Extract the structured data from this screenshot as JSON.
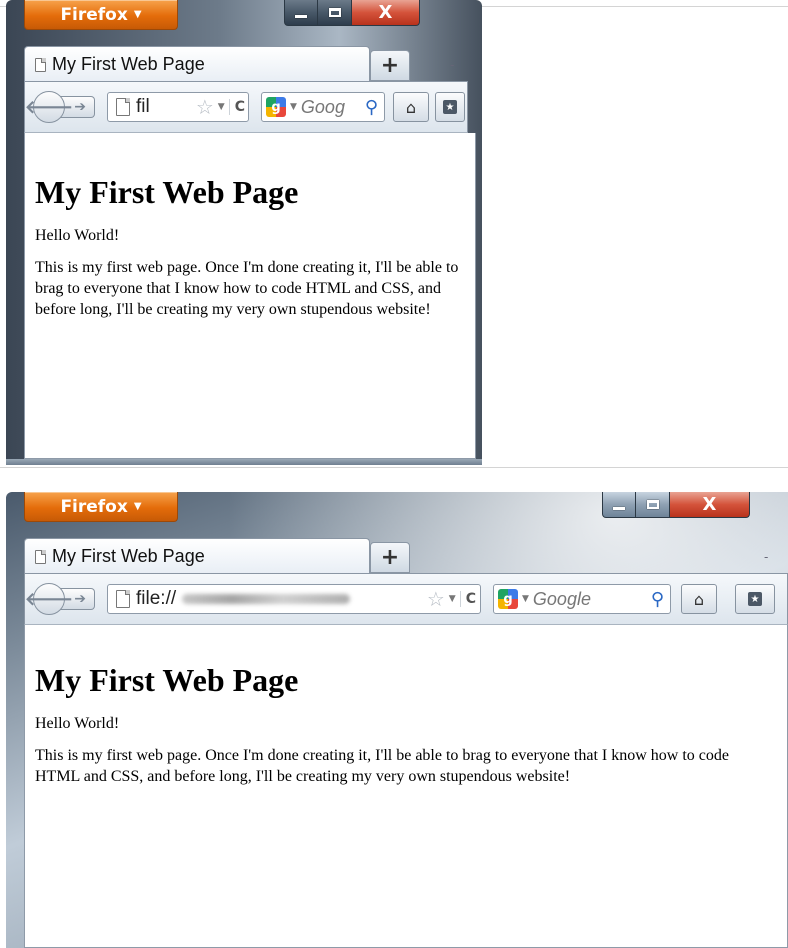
{
  "windows": [
    {
      "firefox_menu": "Firefox",
      "caption": {
        "min": "minimize",
        "max": "maximize",
        "close": "X"
      },
      "tab_title": "My First Web Page",
      "new_tab": "+",
      "tab_list": "-",
      "url_text": "fil",
      "search_placeholder": "Goog",
      "page": {
        "heading": "My First Web Page",
        "para1": "Hello World!",
        "para2": "This is my first web page. Once I'm done creating it, I'll be able to brag to everyone that I know how to code HTML and CSS, and before long, I'll be creating my very own stupendous website!"
      }
    },
    {
      "firefox_menu": "Firefox",
      "caption": {
        "min": "minimize",
        "max": "maximize",
        "close": "X"
      },
      "tab_title": "My First Web Page",
      "new_tab": "+",
      "tab_list": "-",
      "url_text": "file://",
      "search_placeholder": "Google",
      "page": {
        "heading": "My First Web Page",
        "para1": "Hello World!",
        "para2": "This is my first web page. Once I'm done creating it, I'll be able to brag to everyone that I know how to code HTML and CSS, and before long, I'll be creating my very own stupendous website!"
      }
    }
  ],
  "icons": [
    "firefox-dropdown-icon",
    "page-icon",
    "back-icon",
    "forward-icon",
    "star-icon",
    "reload-icon",
    "google-icon",
    "magnifier-icon",
    "home-icon",
    "bookmarks-icon"
  ]
}
